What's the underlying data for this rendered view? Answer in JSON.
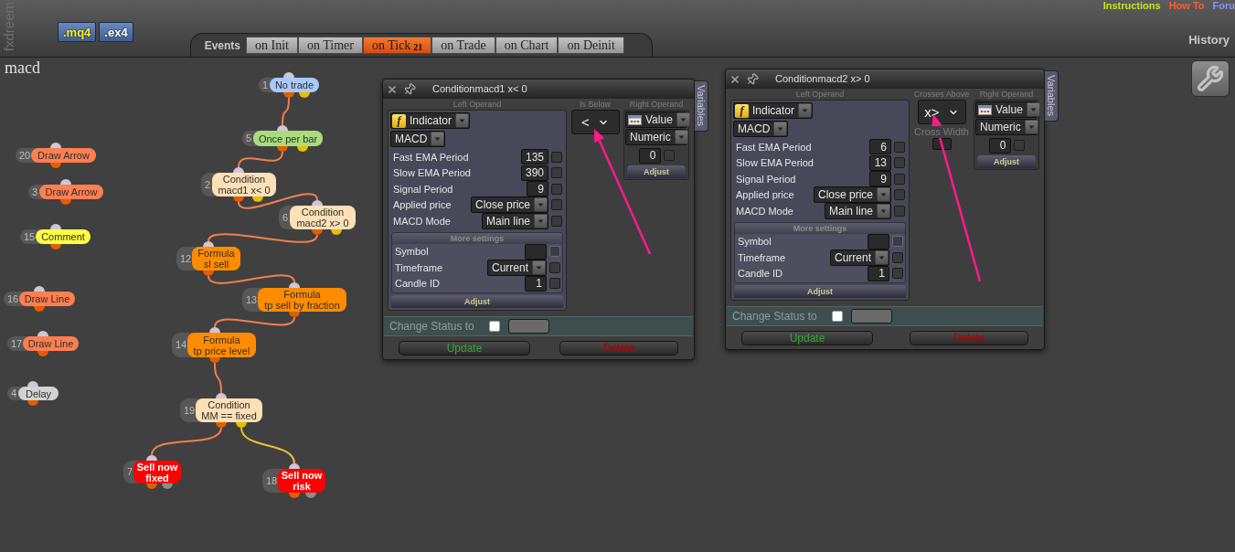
{
  "app": {
    "logo": "fxdreem",
    "export_buttons": [
      {
        "label": ".mq4",
        "kind": "source"
      },
      {
        "label": ".ex4",
        "kind": "compiled"
      }
    ],
    "links": [
      {
        "label": "Instructions",
        "color": "#c4e41a"
      },
      {
        "label": "How To",
        "color": "#ff5c33"
      },
      {
        "label": "Foru",
        "color": "#8f8fff"
      }
    ],
    "history": "History"
  },
  "event_tabs": {
    "label": "Events",
    "items": [
      {
        "label": "on Init",
        "selected": false
      },
      {
        "label": "on Timer",
        "selected": false
      },
      {
        "label": "on Tick",
        "count": "21",
        "selected": true
      },
      {
        "label": "on Trade",
        "selected": false
      },
      {
        "label": "on Chart",
        "selected": false
      },
      {
        "label": "on Deinit",
        "selected": false
      }
    ]
  },
  "project": {
    "title": "macd"
  },
  "nodes": [
    {
      "number": "1",
      "lines": [
        "No trade"
      ],
      "kind": "filter",
      "color": "#a9c9f9"
    },
    {
      "number": "5",
      "lines": [
        "Once per bar"
      ],
      "kind": "filter",
      "color": "#a8dd7c"
    },
    {
      "number": "20",
      "lines": [
        "Draw Arrow"
      ],
      "kind": "action",
      "color": "#ff7f50"
    },
    {
      "number": "3",
      "lines": [
        "Draw Arrow"
      ],
      "kind": "action",
      "color": "#ff7f50"
    },
    {
      "number": "2",
      "lines": [
        "Condition",
        "macd1 x< 0"
      ],
      "kind": "filter",
      "color": "#fde0b6"
    },
    {
      "number": "6",
      "lines": [
        "Condition",
        "macd2 x> 0"
      ],
      "kind": "filter",
      "color": "#fde0b6"
    },
    {
      "number": "15",
      "lines": [
        "Comment"
      ],
      "kind": "action",
      "color": "#ffff44"
    },
    {
      "number": "12",
      "lines": [
        "Formula",
        "sl sell"
      ],
      "kind": "action",
      "color": "#ff8c00"
    },
    {
      "number": "16",
      "lines": [
        "Draw Line"
      ],
      "kind": "action",
      "color": "#ff7f50"
    },
    {
      "number": "13",
      "lines": [
        "Formula",
        "tp sell by fraction"
      ],
      "kind": "action",
      "color": "#ff8c00"
    },
    {
      "number": "17",
      "lines": [
        "Draw Line"
      ],
      "kind": "action",
      "color": "#ff7f50"
    },
    {
      "number": "14",
      "lines": [
        "Formula",
        "tp price level"
      ],
      "kind": "action",
      "color": "#ff8c00"
    },
    {
      "number": "4",
      "lines": [
        "Delay"
      ],
      "kind": "action",
      "color": "#d3d3d3"
    },
    {
      "number": "19",
      "lines": [
        "Condition",
        "MM == fixed"
      ],
      "kind": "filter",
      "color": "#fde0b6"
    },
    {
      "number": "7",
      "lines": [
        "Sell now",
        "fixed"
      ],
      "kind": "trade",
      "color": "#ff0000"
    },
    {
      "number": "18",
      "lines": [
        "Sell now",
        "risk"
      ],
      "kind": "trade",
      "color": "#ff0000"
    }
  ],
  "dialogs": [
    {
      "title": "Conditionmacd1 x< 0",
      "side_tab": "Variables",
      "left_operand": {
        "heading": "Left Operand",
        "source": {
          "icon": "f",
          "value": "Indicator"
        },
        "indicator": "MACD",
        "params": [
          {
            "label": "Fast EMA Period",
            "kind": "input",
            "value": "135",
            "checked": false,
            "disabled": false
          },
          {
            "label": "Slow EMA Period",
            "kind": "input",
            "value": "390",
            "checked": false,
            "disabled": false
          },
          {
            "label": "Signal Period",
            "kind": "input",
            "value": "9",
            "checked": false,
            "disabled": false
          },
          {
            "label": "Applied price",
            "kind": "select",
            "value": "Close price",
            "checked": false,
            "disabled": false
          },
          {
            "label": "MACD Mode",
            "kind": "select",
            "value": "Main line",
            "checked": false,
            "disabled": false
          }
        ],
        "more_settings": {
          "heading": "More settings",
          "params": [
            {
              "label": "Symbol",
              "kind": "input",
              "checked": false,
              "disabled": true
            },
            {
              "label": "Timeframe",
              "kind": "select",
              "value": "Current",
              "checked": false,
              "disabled": false
            },
            {
              "label": "Candle ID",
              "kind": "input",
              "value": "1",
              "checked": false,
              "disabled": false
            }
          ]
        },
        "adjust": "Adjust"
      },
      "operator": {
        "heading": "Is Below",
        "value": "<"
      },
      "right_operand": {
        "heading": "Right Operand",
        "source": "Value",
        "type": "Numeric",
        "value": "0",
        "checked": false,
        "adjust": "Adjust"
      },
      "status": {
        "label": "Change Status to",
        "checked": false
      },
      "buttons": [
        {
          "label": "Update",
          "kind": "update"
        },
        {
          "label": "Delete",
          "kind": "delete"
        }
      ]
    },
    {
      "title": "Conditionmacd2 x> 0",
      "side_tab": "Variables",
      "left_operand": {
        "heading": "Left Operand",
        "source": {
          "icon": "f",
          "value": "Indicator"
        },
        "indicator": "MACD",
        "params": [
          {
            "label": "Fast EMA Period",
            "kind": "input",
            "value": "6",
            "checked": false,
            "disabled": false
          },
          {
            "label": "Slow EMA Period",
            "kind": "input",
            "value": "13",
            "checked": false,
            "disabled": false
          },
          {
            "label": "Signal Period",
            "kind": "input",
            "value": "9",
            "checked": false,
            "disabled": false
          },
          {
            "label": "Applied price",
            "kind": "select",
            "value": "Close price",
            "checked": false,
            "disabled": false
          },
          {
            "label": "MACD Mode",
            "kind": "select",
            "value": "Main line",
            "checked": false,
            "disabled": false
          }
        ],
        "more_settings": {
          "heading": "More settings",
          "params": [
            {
              "label": "Symbol",
              "kind": "input",
              "checked": false,
              "disabled": true
            },
            {
              "label": "Timeframe",
              "kind": "select",
              "value": "Current",
              "checked": false,
              "disabled": false
            },
            {
              "label": "Candle ID",
              "kind": "input",
              "value": "1",
              "checked": false,
              "disabled": false
            }
          ]
        },
        "adjust": "Adjust"
      },
      "operator": {
        "heading": "Crosses Above",
        "value": "x>",
        "width_label": "Cross Width"
      },
      "right_operand": {
        "heading": "Right Operand",
        "source": "Value",
        "type": "Numeric",
        "value": "0",
        "checked": false,
        "adjust": "Adjust"
      },
      "status": {
        "label": "Change Status to",
        "checked": false
      },
      "buttons": [
        {
          "label": "Update",
          "kind": "update"
        },
        {
          "label": "Delete",
          "kind": "delete"
        }
      ]
    }
  ],
  "annotations": [
    {
      "kind": "arrow"
    },
    {
      "kind": "arrow"
    }
  ]
}
